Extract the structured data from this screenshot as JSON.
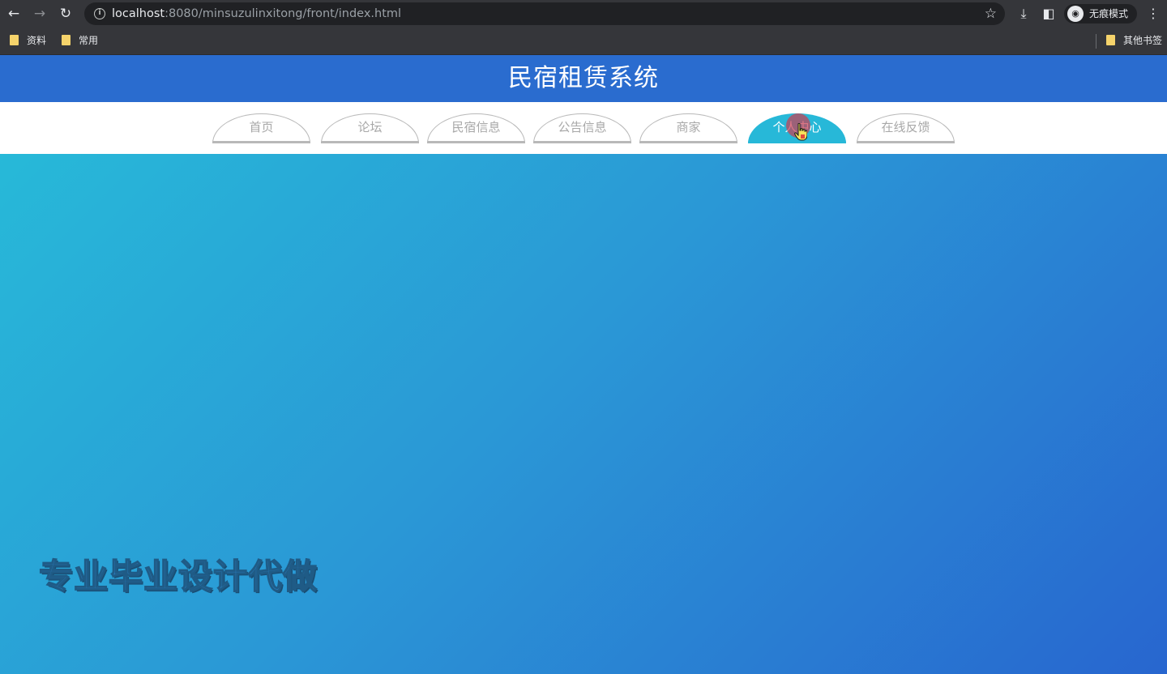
{
  "browser": {
    "url_host": "localhost",
    "url_rest": ":8080/minsuzulinxitong/front/index.html",
    "incognito_label": "无痕模式",
    "bookmarks": [
      "资料",
      "常用"
    ],
    "other_bookmarks": "其他书签"
  },
  "site": {
    "title": "民宿租赁系统",
    "nav": [
      {
        "label": "首页",
        "active": false
      },
      {
        "label": "论坛",
        "active": false
      },
      {
        "label": "民宿信息",
        "active": false
      },
      {
        "label": "公告信息",
        "active": false
      },
      {
        "label": "商家",
        "active": false
      },
      {
        "label": "个人中心",
        "active": true
      },
      {
        "label": "在线反馈",
        "active": false
      }
    ],
    "watermark": "专业毕业设计代做"
  },
  "colors": {
    "header": "#2a6ccf",
    "active_tab": "#27b8d8",
    "hero_gradient_start": "#27b9d8",
    "hero_gradient_end": "#2866cf"
  }
}
